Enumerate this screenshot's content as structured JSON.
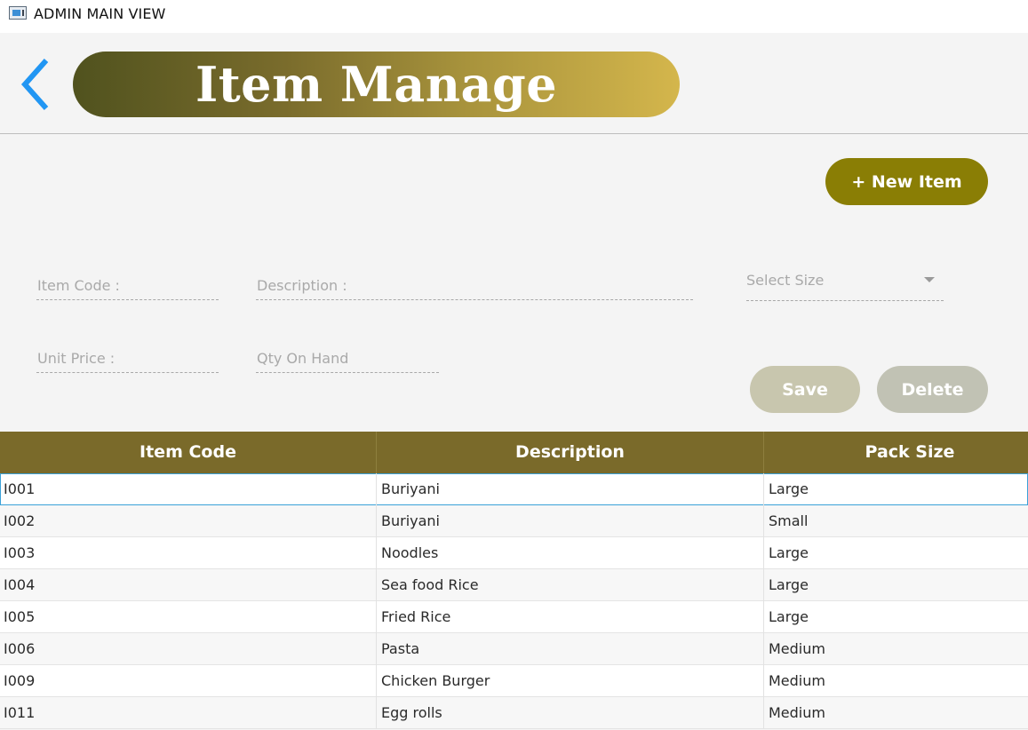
{
  "window": {
    "title": "ADMIN MAIN VIEW"
  },
  "header": {
    "title": "Item Manage",
    "back_icon": "chevron-left-icon"
  },
  "toolbar": {
    "new_item_label": "+ New Item"
  },
  "form": {
    "item_code_placeholder": "Item Code :",
    "description_placeholder": "Description :",
    "select_size_placeholder": "Select Size",
    "unit_price_placeholder": "Unit Price :",
    "qty_on_hand_placeholder": "Qty On Hand",
    "save_label": "Save",
    "delete_label": "Delete"
  },
  "table": {
    "columns": [
      "Item Code",
      "Description",
      "Pack Size"
    ],
    "rows": [
      [
        "I001",
        "Buriyani",
        "Large"
      ],
      [
        "I002",
        "Buriyani",
        "Small"
      ],
      [
        "I003",
        "Noodles",
        "Large"
      ],
      [
        "I004",
        "Sea food Rice",
        "Large"
      ],
      [
        "I005",
        "Fried Rice",
        "Large"
      ],
      [
        "I006",
        "Pasta",
        "Medium"
      ],
      [
        "I009",
        "Chicken Burger",
        "Medium"
      ],
      [
        "I011",
        "Egg rolls",
        "Medium"
      ]
    ],
    "selected_row": 0
  },
  "colors": {
    "banner_start": "#50521e",
    "banner_end": "#d4b64c",
    "new_item_button": "#8a7e05",
    "table_header": "#7a6a2a",
    "back_chevron": "#2196f3",
    "selection_outline": "#3aa1d8"
  }
}
